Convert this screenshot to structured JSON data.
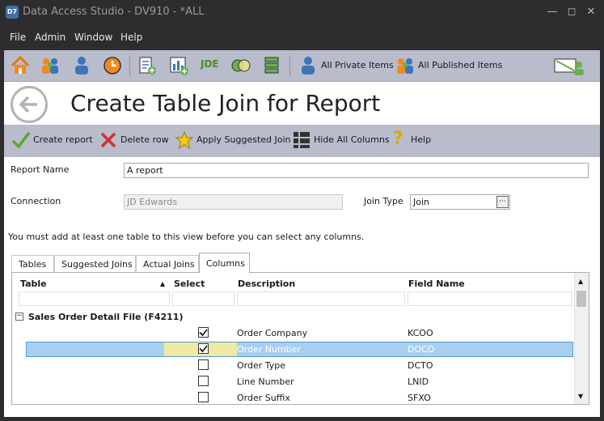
{
  "window": {
    "app_icon": "D7",
    "title": "Data Access Studio - DV910 - *ALL"
  },
  "menu": [
    "File",
    "Admin",
    "Window",
    "Help"
  ],
  "toolbar": {
    "all_private": "All Private Items",
    "all_published": "All Published Items",
    "jde_label": "JDE"
  },
  "page": {
    "title": "Create Table Join for Report"
  },
  "actions": {
    "create": "Create report",
    "delete": "Delete row",
    "apply": "Apply Suggested Join",
    "hide": "Hide All Columns",
    "help": "Help"
  },
  "form": {
    "report_name_label": "Report Name",
    "report_name_value": "A report",
    "connection_label": "Connection",
    "connection_value": "JD Edwards",
    "join_type_label": "Join Type",
    "join_type_value": "Join",
    "ellipsis": "···"
  },
  "message": "You must add at least one table to this view before you can select any columns.",
  "tabs": [
    "Tables",
    "Suggested Joins",
    "Actual Joins",
    "Columns"
  ],
  "grid": {
    "headers": {
      "table": "Table",
      "select": "Select",
      "description": "Description",
      "field": "Field Name"
    },
    "group": {
      "toggle": "−",
      "label": "Sales Order Detail File (F4211)"
    },
    "rows": [
      {
        "description": "Order Company",
        "field": "KCOO",
        "checked": true
      },
      {
        "description": "Order Number",
        "field": "DOCO",
        "checked": true
      },
      {
        "description": "Order Type",
        "field": "DCTO",
        "checked": false
      },
      {
        "description": "Line Number",
        "field": "LNID",
        "checked": false
      },
      {
        "description": "Order Suffix",
        "field": "SFXO",
        "checked": false
      }
    ]
  },
  "colors": {
    "toolbar": "#b8bccb",
    "selection": "#a8cff0",
    "select_highlight": "#efe9a4"
  }
}
